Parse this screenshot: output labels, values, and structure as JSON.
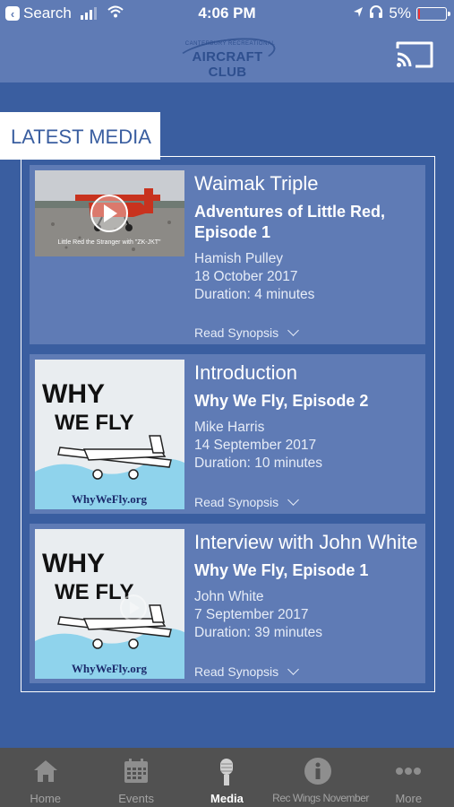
{
  "status_bar": {
    "back_label": "Search",
    "time": "4:06 PM",
    "battery": "5%",
    "battery_level_fraction": 0.05
  },
  "header": {
    "logo_small_text": "CANTERBURY RECREATIONAL",
    "logo_text": "AIRCRAFT CLUB",
    "cast_icon": "cast-icon"
  },
  "section": {
    "title": "LATEST MEDIA"
  },
  "media": [
    {
      "series": "Waimak Triple",
      "title": "Adventures of Little Red, Episode 1",
      "presenter": "Hamish Pulley",
      "date": "18 October 2017",
      "duration": "Duration: 4 minutes",
      "synopsis_label": "Read Synopsis",
      "thumb_caption": "Little Red the Stranger with \"ZK-JKT\""
    },
    {
      "series": "Introduction",
      "title": "Why We Fly, Episode 2",
      "presenter": "Mike Harris",
      "date": "14 September 2017",
      "duration": "Duration: 10 minutes",
      "synopsis_label": "Read Synopsis",
      "thumb_line1": "WHY",
      "thumb_line2": "WE FLY",
      "thumb_url": "WhyWeFly.org"
    },
    {
      "series": "Interview with John White",
      "title": "Why We Fly, Episode 1",
      "presenter": "John White",
      "date": "7 September 2017",
      "duration": "Duration: 39 minutes",
      "synopsis_label": "Read Synopsis",
      "thumb_line1": "WHY",
      "thumb_line2": "WE FLY",
      "thumb_url": "WhyWeFly.org"
    }
  ],
  "tabbar": {
    "tabs": [
      {
        "label": "Home",
        "icon": "home-icon"
      },
      {
        "label": "Events",
        "icon": "calendar-icon"
      },
      {
        "label": "Media",
        "icon": "microphone-icon",
        "active": true
      },
      {
        "label": "Rec Wings November",
        "icon": "info-icon"
      },
      {
        "label": "More",
        "icon": "more-icon"
      }
    ]
  },
  "colors": {
    "background": "#3a5ea0",
    "card": "#5f7bb5",
    "tabbar": "#515151",
    "logo": "#2e4f8e"
  }
}
